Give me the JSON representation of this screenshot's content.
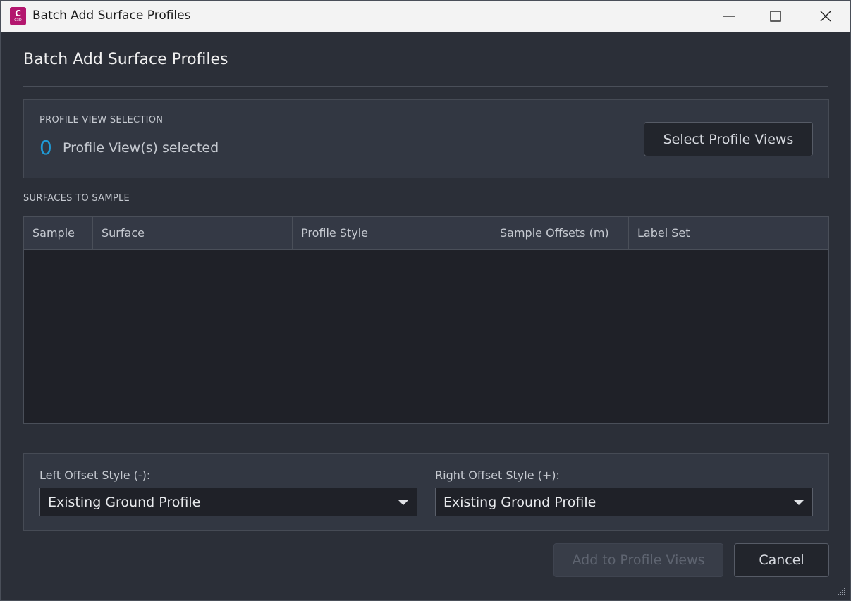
{
  "window": {
    "title": "Batch Add Surface Profiles",
    "app_icon_letter": "C",
    "app_icon_sub": "C3D",
    "app_icon_color": "#b3166e"
  },
  "dialog": {
    "title": "Batch Add Surface Profiles"
  },
  "profile_view_selection": {
    "section_label": "PROFILE VIEW SELECTION",
    "count": "0",
    "count_text": "Profile View(s) selected",
    "select_button": "Select Profile Views"
  },
  "surfaces": {
    "section_label": "SURFACES TO SAMPLE",
    "columns": [
      "Sample",
      "Surface",
      "Profile Style",
      "Sample Offsets (m)",
      "Label Set"
    ],
    "rows": []
  },
  "offsets": {
    "left_label": "Left Offset Style (-):",
    "left_value": "Existing Ground Profile",
    "right_label": "Right Offset Style (+):",
    "right_value": "Existing Ground Profile"
  },
  "footer": {
    "add_button": "Add to Profile Views",
    "cancel_button": "Cancel"
  },
  "colors": {
    "accent": "#1f9bd7",
    "background": "#2b2f38"
  }
}
